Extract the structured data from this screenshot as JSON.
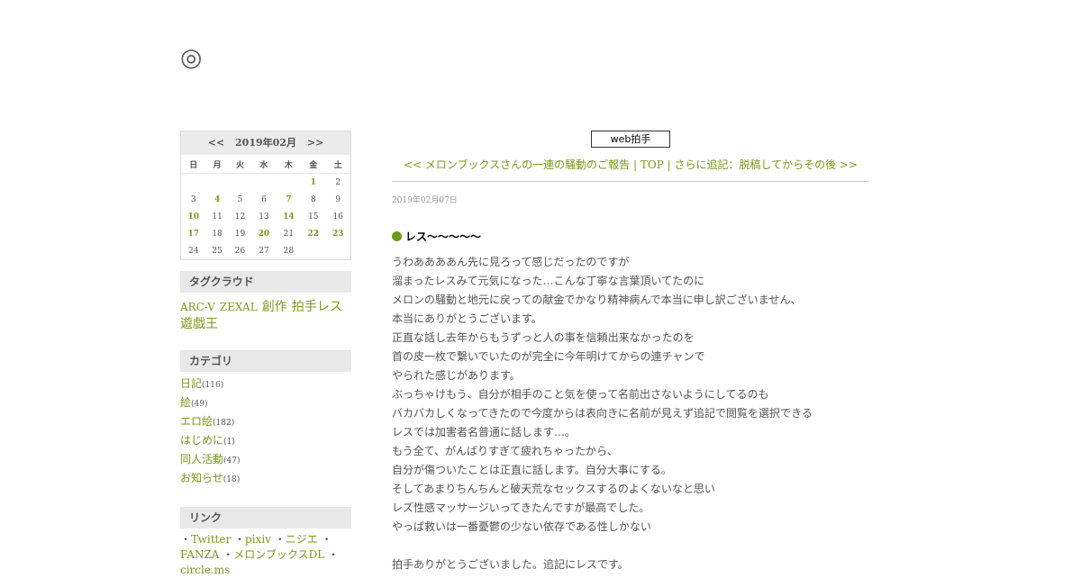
{
  "site": {
    "title": "◎"
  },
  "calendar": {
    "prev": "<<",
    "month": "2019年02月",
    "next": ">>",
    "weekdays": [
      "日",
      "月",
      "火",
      "水",
      "木",
      "金",
      "土"
    ],
    "weeks": [
      [
        "",
        "",
        "",
        "",
        "",
        "1",
        "2"
      ],
      [
        "3",
        "4",
        "5",
        "6",
        "7",
        "8",
        "9"
      ],
      [
        "10",
        "11",
        "12",
        "13",
        "14",
        "15",
        "16"
      ],
      [
        "17",
        "18",
        "19",
        "20",
        "21",
        "22",
        "23"
      ],
      [
        "24",
        "25",
        "26",
        "27",
        "28",
        "",
        ""
      ]
    ],
    "linked_days": [
      "1",
      "4",
      "7",
      "10",
      "14",
      "17",
      "20",
      "22",
      "23"
    ]
  },
  "tagcloud": {
    "heading": "タグクラウド",
    "tags": [
      {
        "label": "ARC-V",
        "size": "sm"
      },
      {
        "label": "ZEXAL",
        "size": "sm"
      },
      {
        "label": "創作",
        "size": "lg"
      },
      {
        "label": "拍手レス",
        "size": "lg"
      },
      {
        "label": "遊戯王",
        "size": "lg"
      }
    ]
  },
  "categories": {
    "heading": "カテゴリ",
    "items": [
      {
        "label": "日記",
        "count": "(116)"
      },
      {
        "label": "絵",
        "count": "(49)"
      },
      {
        "label": "エロ絵",
        "count": "(182)"
      },
      {
        "label": "はじめに",
        "count": "(1)"
      },
      {
        "label": "同人活動",
        "count": "(47)"
      },
      {
        "label": "お知らせ",
        "count": "(18)"
      }
    ]
  },
  "links": {
    "heading": "リンク",
    "items": [
      "Twitter",
      "pixiv",
      "ニジエ",
      "FANZA",
      "メロンブックスDL",
      "circle.ms"
    ]
  },
  "main": {
    "clap_button": "web拍手",
    "nav": {
      "prev": "<< メロンブックスさんの一連の騒動のご報告",
      "top": "TOP",
      "next": "さらに追記：脱稿してからその後 >>"
    },
    "post": {
      "date": "2019年02月07日",
      "title": "レス～～～～～",
      "lines": [
        "うわああああん先に見ろって感じだったのですが",
        "溜まったレスみて元気になった…こんな丁寧な言葉頂いてたのに",
        "メロンの騒動と地元に戻っての献金でかなり精神病んで本当に申し訳ございません、",
        "本当にありがとうございます。",
        "正直な話し去年からもうずっと人の事を信頼出来なかったのを",
        "首の皮一枚で繋いでいたのが完全に今年明けてからの連チャンで",
        "やられた感じがあります。",
        "ぶっちゃけもう、自分が相手のこと気を使って名前出さないようにしてるのも",
        "バカバカしくなってきたので今度からは表向きに名前が見えず追記で閲覧を選択できる",
        "レスでは加害者名普通に話します…。",
        "もう全て、がんばりすぎて疲れちゃったから、",
        "自分が傷ついたことは正直に話します。自分大事にする。",
        "そしてあまりちんちんと破天荒なセックスするのよくないなと思い",
        "レズ性感マッサージいってきたんですが最高でした。",
        "やっぱ救いは一番憂鬱の少ない依存である性しかない",
        "",
        "拍手ありがとうございました。追記にレスです。"
      ]
    }
  },
  "colors": {
    "link": "#7a9a1a",
    "bullet": "#6c9a1a",
    "sidebar_heading_bg": "#e8e8e8"
  }
}
